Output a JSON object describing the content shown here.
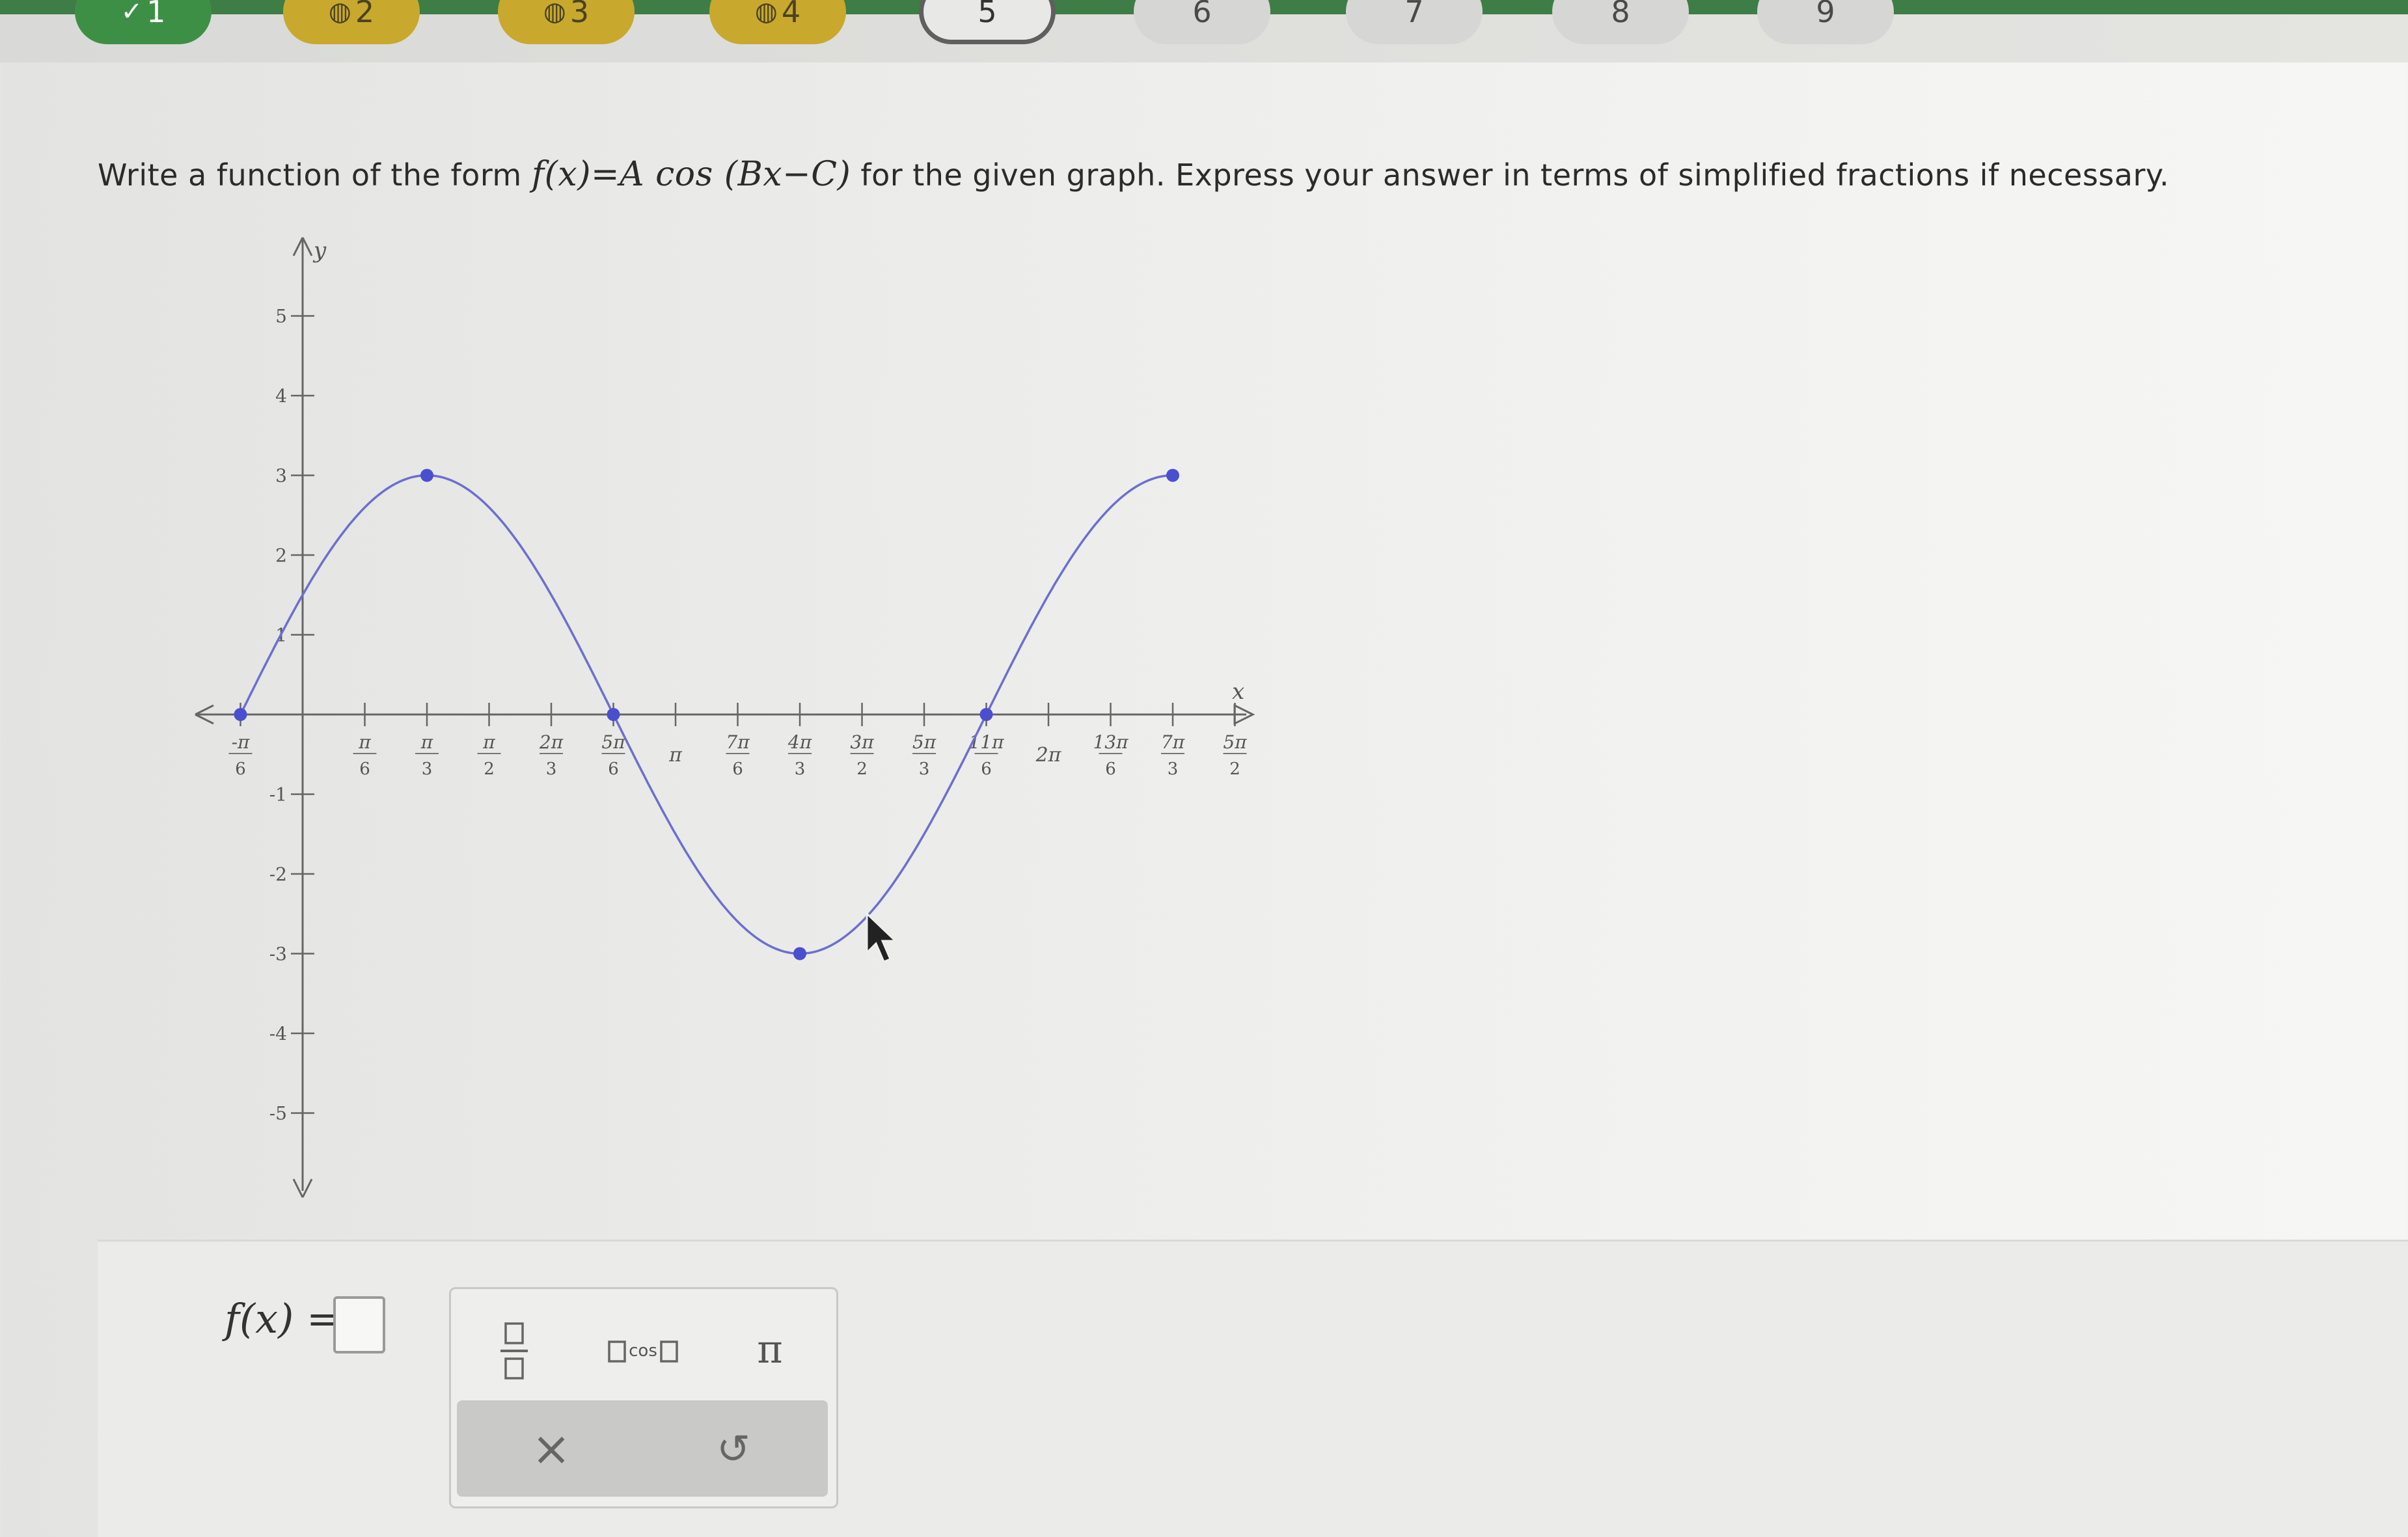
{
  "nav": {
    "questions": [
      {
        "label": "1",
        "status": "done",
        "glyph": "✓"
      },
      {
        "label": "2",
        "status": "partial",
        "glyph": "◍"
      },
      {
        "label": "3",
        "status": "partial",
        "glyph": "◍"
      },
      {
        "label": "4",
        "status": "partial",
        "glyph": "◍"
      },
      {
        "label": "5",
        "status": "current",
        "glyph": ""
      },
      {
        "label": "6",
        "status": "todo",
        "glyph": ""
      },
      {
        "label": "7",
        "status": "todo",
        "glyph": ""
      },
      {
        "label": "8",
        "status": "todo",
        "glyph": ""
      },
      {
        "label": "9",
        "status": "todo",
        "glyph": ""
      }
    ]
  },
  "question": {
    "prefix": "Write a function of the form ",
    "formula": "f(x)=A cos (Bx−C)",
    "suffix": " for the given graph. Express your answer in terms of simplified fractions if necessary."
  },
  "chart_data": {
    "type": "line",
    "xlabel": "x",
    "ylabel": "y",
    "xlim": [
      -0.5236,
      7.854
    ],
    "ylim": [
      -5,
      5
    ],
    "x_ticks": [
      "-π/6",
      "π/6",
      "π/3",
      "π/2",
      "2π/3",
      "5π/6",
      "π",
      "7π/6",
      "4π/3",
      "3π/2",
      "5π/3",
      "11π/6",
      "2π",
      "13π/6",
      "7π/3",
      "5π/2"
    ],
    "y_ticks": [
      "5",
      "4",
      "3",
      "2",
      "1",
      "-1",
      "-2",
      "-3",
      "-4",
      "-5"
    ],
    "key_points": [
      {
        "x": "-π/6",
        "y": 0
      },
      {
        "x": "π/3",
        "y": 3
      },
      {
        "x": "5π/6",
        "y": 0
      },
      {
        "x": "4π/3",
        "y": -3
      },
      {
        "x": "11π/6",
        "y": 0
      },
      {
        "x": "7π/3",
        "y": 3
      }
    ],
    "curve": {
      "A": 3,
      "B": 1,
      "C": 1.0472
    }
  },
  "answer": {
    "label": "f(x) ="
  },
  "palette": {
    "fraction": "fraction",
    "cos_label": "cos",
    "pi": "π",
    "clear": "×",
    "undo": "↺"
  }
}
